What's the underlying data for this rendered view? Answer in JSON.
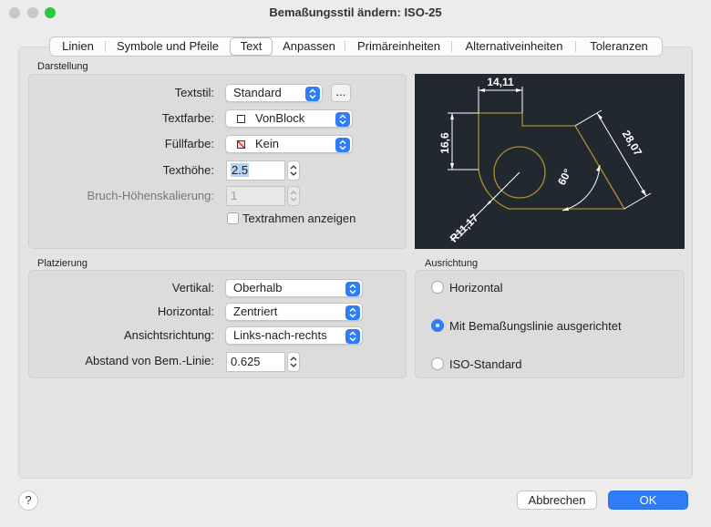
{
  "window": {
    "title": "Bemaßungsstil ändern: ISO-25",
    "traffic_colors": {
      "close": "#c6c6c6",
      "minimize": "#c6c6c6",
      "zoom": "#28c840"
    }
  },
  "tabs": [
    {
      "label": "Linien",
      "active": false
    },
    {
      "label": "Symbole und Pfeile",
      "active": false
    },
    {
      "label": "Text",
      "active": true
    },
    {
      "label": "Anpassen",
      "active": false
    },
    {
      "label": "Primäreinheiten",
      "active": false
    },
    {
      "label": "Alternativeinheiten",
      "active": false
    },
    {
      "label": "Toleranzen",
      "active": false
    }
  ],
  "darstellung": {
    "group_label": "Darstellung",
    "textstil_label": "Textstil:",
    "textstil_value": "Standard",
    "ellipsis_label": "...",
    "textfarbe_label": "Textfarbe:",
    "textfarbe_value": "VonBlock",
    "fuellfarbe_label": "Füllfarbe:",
    "fuellfarbe_value": "Kein",
    "texthoehe_label": "Texthöhe:",
    "texthoehe_value": "2.5",
    "bruch_label": "Bruch-Höhenskalierung:",
    "bruch_value": "1",
    "textrahmen_label": "Textrahmen anzeigen",
    "textrahmen_checked": false
  },
  "preview": {
    "dim_top": "14,11",
    "dim_left": "16,6",
    "dim_right": "28,07",
    "dim_angle": "60°",
    "dim_radius": "R11,17"
  },
  "platzierung": {
    "group_label": "Platzierung",
    "vertikal_label": "Vertikal:",
    "vertikal_value": "Oberhalb",
    "horizontal_label": "Horizontal:",
    "horizontal_value": "Zentriert",
    "ansicht_label": "Ansichtsrichtung:",
    "ansicht_value": "Links-nach-rechts",
    "abstand_label": "Abstand von Bem.-Linie:",
    "abstand_value": "0.625"
  },
  "ausrichtung": {
    "group_label": "Ausrichtung",
    "options": [
      {
        "label": "Horizontal",
        "selected": false
      },
      {
        "label": "Mit Bemaßungslinie ausgerichtet",
        "selected": true
      },
      {
        "label": "ISO-Standard",
        "selected": false
      }
    ]
  },
  "footer": {
    "help_label": "?",
    "cancel_label": "Abbrechen",
    "ok_label": "OK"
  }
}
